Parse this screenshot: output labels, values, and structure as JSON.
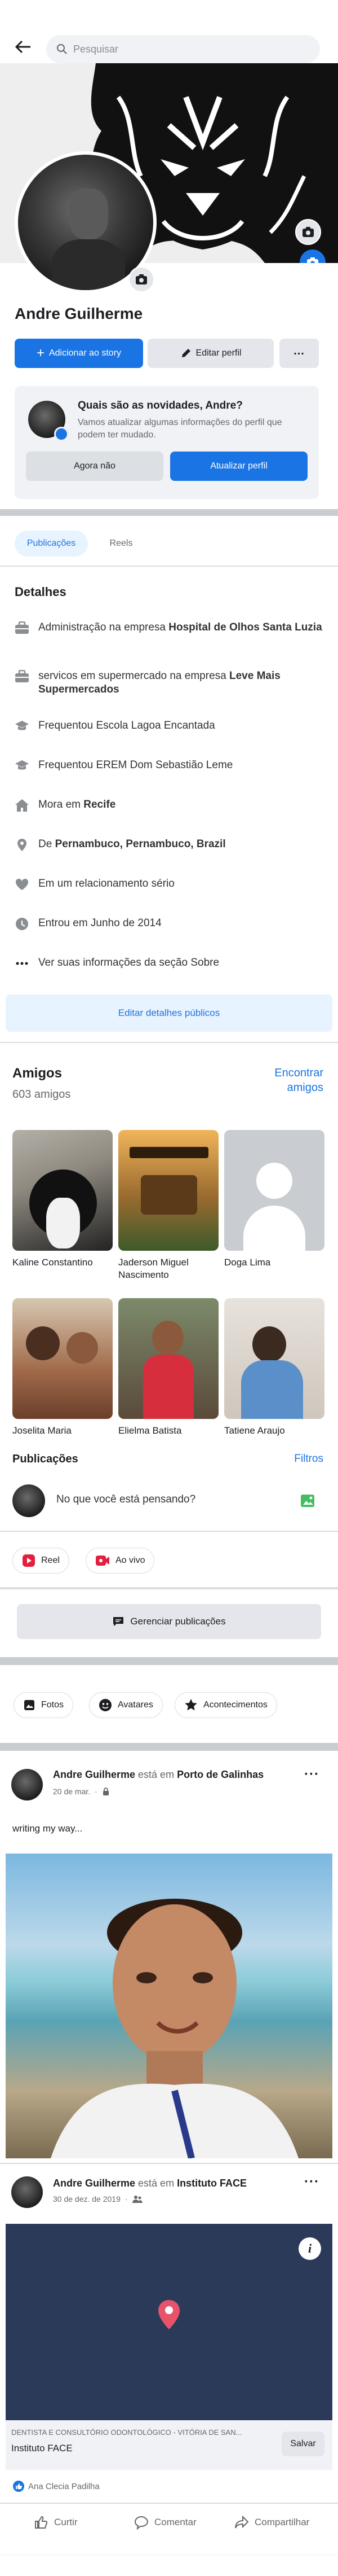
{
  "header": {
    "search_placeholder": "Pesquisar"
  },
  "profile": {
    "name": "Andre Guilherme"
  },
  "actions": {
    "add_story": "Adicionar ao story",
    "edit_profile": "Editar perfil",
    "more": "..."
  },
  "update_card": {
    "title": "Quais são as novidades, Andre?",
    "body": "Vamos atualizar algumas informações do perfil que podem ter mudado.",
    "dismiss": "Agora não",
    "update": "Atualizar perfil"
  },
  "tabs": [
    "Publicações",
    "Reels"
  ],
  "details": {
    "title": "Detalhes",
    "rows": [
      {
        "icon": "briefcase-icon",
        "pre": "Administração na empresa ",
        "bold": "Hospital de Olhos Santa Luzia",
        "post": ""
      },
      {
        "icon": "briefcase-icon",
        "pre": "servicos em supermercado na empresa ",
        "bold": "Leve Mais Supermercados",
        "post": ""
      },
      {
        "icon": "graduation-cap-icon",
        "pre": "Frequentou Escola Lagoa Encantada",
        "bold": "",
        "post": ""
      },
      {
        "icon": "graduation-cap-icon",
        "pre": "Frequentou EREM Dom Sebastião Leme",
        "bold": "",
        "post": ""
      },
      {
        "icon": "house-icon",
        "pre": "Mora em ",
        "bold": "Recife",
        "post": ""
      },
      {
        "icon": "location-pin-icon",
        "pre": "De ",
        "bold": "Pernambuco, Pernambuco, Brazil",
        "post": ""
      },
      {
        "icon": "heart-icon",
        "pre": "Em um relacionamento sério",
        "bold": "",
        "post": ""
      },
      {
        "icon": "clock-icon",
        "pre": "Entrou em Junho de 2014",
        "bold": "",
        "post": ""
      },
      {
        "icon": "dots-icon",
        "pre": "Ver suas informações da seção Sobre",
        "bold": "",
        "post": ""
      }
    ],
    "edit_button": "Editar detalhes públicos"
  },
  "friends": {
    "title": "Amigos",
    "count": "603 amigos",
    "find": "Encontrar amigos",
    "list": [
      {
        "name": "Kaline Constantino"
      },
      {
        "name": "Jaderson Miguel Nascimento"
      },
      {
        "name": "Doga Lima"
      },
      {
        "name": "Joselita Maria"
      },
      {
        "name": "Elielma Batista"
      },
      {
        "name": "Tatiene Araujo"
      }
    ]
  },
  "posts_section": {
    "title": "Publicações",
    "filters": "Filtros",
    "composer": "No que você está pensando?",
    "reel": "Reel",
    "live": "Ao vivo",
    "manage": "Gerenciar publicações"
  },
  "media_tabs": [
    "Fotos",
    "Avatares",
    "Acontecimentos"
  ],
  "post1": {
    "author": "Andre Guilherme",
    "verb": " está em ",
    "place": "Porto de Galinhas",
    "date": "20 de mar.",
    "text": "writing my way..."
  },
  "post2": {
    "author": "Andre Guilherme",
    "verb": " está em ",
    "place": "Instituto  FACE",
    "date": "30 de dez. de 2019",
    "map_caption": "DENTISTA E CONSULTÓRIO ODONTOLÓGICO - VITÓRIA DE SAN...",
    "map_title": "Instituto  FACE",
    "save": "Salvar",
    "reaction": "Ana Clecia Padilha"
  },
  "post_actions": {
    "like": "Curtir",
    "comment": "Comentar",
    "share": "Compartilhar"
  },
  "colors": {
    "accent": "#1b74e4",
    "divider": "#c9ccd1"
  }
}
